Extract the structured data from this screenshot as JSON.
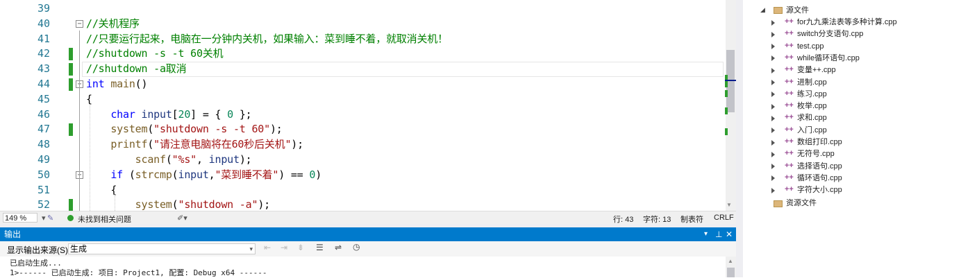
{
  "editor": {
    "lines": [
      {
        "n": "39",
        "fold": "",
        "chg": false,
        "tokens": []
      },
      {
        "n": "40",
        "fold": "−",
        "chg": false,
        "tokens": [
          {
            "t": "//关机程序",
            "c": "c-cm"
          }
        ]
      },
      {
        "n": "41",
        "fold": "",
        "chg": false,
        "tokens": [
          {
            "t": "//只要运行起来，电脑在一分钟内关机，如果输入：菜到睡不着，就取消关机！",
            "c": "c-cm"
          }
        ]
      },
      {
        "n": "42",
        "fold": "",
        "chg": true,
        "tokens": [
          {
            "t": "//shutdown -s -t 60关机",
            "c": "c-cm"
          }
        ]
      },
      {
        "n": "43",
        "fold": "",
        "chg": true,
        "current": true,
        "tokens": [
          {
            "t": "//shutdown -a取消",
            "c": "c-cm"
          }
        ]
      },
      {
        "n": "44",
        "fold": "−",
        "chg": true,
        "tokens": [
          {
            "t": "int",
            "c": "c-kw"
          },
          {
            "t": " ",
            "c": "c-pl"
          },
          {
            "t": "main",
            "c": "c-fn"
          },
          {
            "t": "()",
            "c": "c-pl"
          }
        ]
      },
      {
        "n": "45",
        "fold": "",
        "chg": false,
        "tokens": [
          {
            "t": "{",
            "c": "c-pl"
          }
        ]
      },
      {
        "n": "46",
        "fold": "",
        "chg": false,
        "tokens": [
          {
            "t": "    ",
            "c": "c-pl"
          },
          {
            "t": "char",
            "c": "c-kw"
          },
          {
            "t": " ",
            "c": "c-pl"
          },
          {
            "t": "input",
            "c": "c-id"
          },
          {
            "t": "[",
            "c": "c-pl"
          },
          {
            "t": "20",
            "c": "c-num"
          },
          {
            "t": "] = { ",
            "c": "c-pl"
          },
          {
            "t": "0",
            "c": "c-num"
          },
          {
            "t": " };",
            "c": "c-pl"
          }
        ]
      },
      {
        "n": "47",
        "fold": "",
        "chg": true,
        "tokens": [
          {
            "t": "    ",
            "c": "c-pl"
          },
          {
            "t": "system",
            "c": "c-fn"
          },
          {
            "t": "(",
            "c": "c-pl"
          },
          {
            "t": "\"shutdown -s -t 60\"",
            "c": "c-str"
          },
          {
            "t": ");",
            "c": "c-pl"
          }
        ]
      },
      {
        "n": "48",
        "fold": "",
        "chg": false,
        "tokens": [
          {
            "t": "    ",
            "c": "c-pl"
          },
          {
            "t": "printf",
            "c": "c-fn"
          },
          {
            "t": "(",
            "c": "c-pl"
          },
          {
            "t": "\"请注意电脑将在60秒后关机\"",
            "c": "c-str"
          },
          {
            "t": ");",
            "c": "c-pl"
          }
        ]
      },
      {
        "n": "49",
        "fold": "",
        "chg": false,
        "tokens": [
          {
            "t": "        ",
            "c": "c-pl"
          },
          {
            "t": "scanf",
            "c": "c-fn"
          },
          {
            "t": "(",
            "c": "c-pl"
          },
          {
            "t": "\"%s\"",
            "c": "c-str"
          },
          {
            "t": ", ",
            "c": "c-pl"
          },
          {
            "t": "input",
            "c": "c-id"
          },
          {
            "t": ");",
            "c": "c-pl"
          }
        ]
      },
      {
        "n": "50",
        "fold": "−",
        "chg": false,
        "tokens": [
          {
            "t": "    ",
            "c": "c-pl"
          },
          {
            "t": "if",
            "c": "c-kw"
          },
          {
            "t": " (",
            "c": "c-pl"
          },
          {
            "t": "strcmp",
            "c": "c-fn"
          },
          {
            "t": "(",
            "c": "c-pl"
          },
          {
            "t": "input",
            "c": "c-id"
          },
          {
            "t": ",",
            "c": "c-pl"
          },
          {
            "t": "\"菜到睡不着\"",
            "c": "c-str"
          },
          {
            "t": ") == ",
            "c": "c-pl"
          },
          {
            "t": "0",
            "c": "c-num"
          },
          {
            "t": ")",
            "c": "c-pl"
          }
        ]
      },
      {
        "n": "51",
        "fold": "",
        "chg": false,
        "tokens": [
          {
            "t": "    {",
            "c": "c-pl"
          }
        ]
      },
      {
        "n": "52",
        "fold": "",
        "chg": true,
        "tokens": [
          {
            "t": "        ",
            "c": "c-pl"
          },
          {
            "t": "system",
            "c": "c-fn"
          },
          {
            "t": "(",
            "c": "c-pl"
          },
          {
            "t": "\"shutdown -a\"",
            "c": "c-str"
          },
          {
            "t": ");",
            "c": "c-pl"
          }
        ]
      }
    ]
  },
  "status": {
    "zoom": "149 %",
    "issues": "未找到相关问题",
    "line": "行: 43",
    "col": "字符: 13",
    "tabs": "制表符",
    "eol": "CRLF"
  },
  "output": {
    "title": "输出",
    "source_label": "显示输出来源(S):",
    "source_value": "生成",
    "lines": [
      "已启动生成...",
      "1>------ 已启动生成: 项目: Project1, 配置: Debug x64 ------"
    ]
  },
  "solution": {
    "source_folder": "源文件",
    "resource_folder": "资源文件",
    "files": [
      "for九九乘法表等多种计算.cpp",
      "switch分支语句.cpp",
      "test.cpp",
      "while循环语句.cpp",
      "变量++.cpp",
      "进制.cpp",
      "练习.cpp",
      "枚举.cpp",
      "求和.cpp",
      "入门.cpp",
      "数组打印.cpp",
      "无符号.cpp",
      "选择语句.cpp",
      "循环语句.cpp",
      "字符大小.cpp"
    ]
  }
}
